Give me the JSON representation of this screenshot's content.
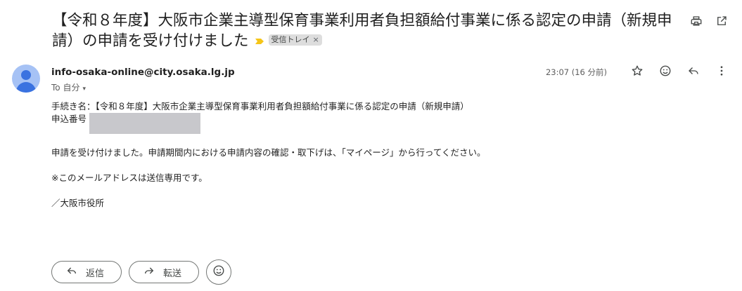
{
  "subject": "【令和８年度】大阪市企業主導型保育事業利用者負担額給付事業に係る認定の申請（新規申請）の申請を受け付けました",
  "label": "受信トレイ",
  "label_remove": "×",
  "sender": "info-osaka-online@city.osaka.lg.jp",
  "recipient": "To 自分",
  "caret": "▾",
  "time": "23:07 (16 分前)",
  "body": {
    "line1": "手続き名：【令和８年度】大阪市企業主導型保育事業利用者負担額給付事業に係る認定の申請（新規申請）",
    "line2_label": "申込番号",
    "line3": "申請を受け付けました。申請期間内における申請内容の確認・取下げは、「マイページ」から行ってください。",
    "line4": "※このメールアドレスは送信専用です。",
    "line5": "／大阪市役所"
  },
  "buttons": {
    "reply": "返信",
    "forward": "転送"
  },
  "icons": [
    "print-icon",
    "open-in-new-icon",
    "importance-marker-icon",
    "star-icon",
    "emoji-icon",
    "reply-icon",
    "more-vert-icon",
    "forward-icon"
  ],
  "colors": {
    "avatar_bg": "#a6c2f5",
    "avatar_fg": "#3a72e0",
    "importance": "#f5c518",
    "label_bg": "#dddddd"
  }
}
